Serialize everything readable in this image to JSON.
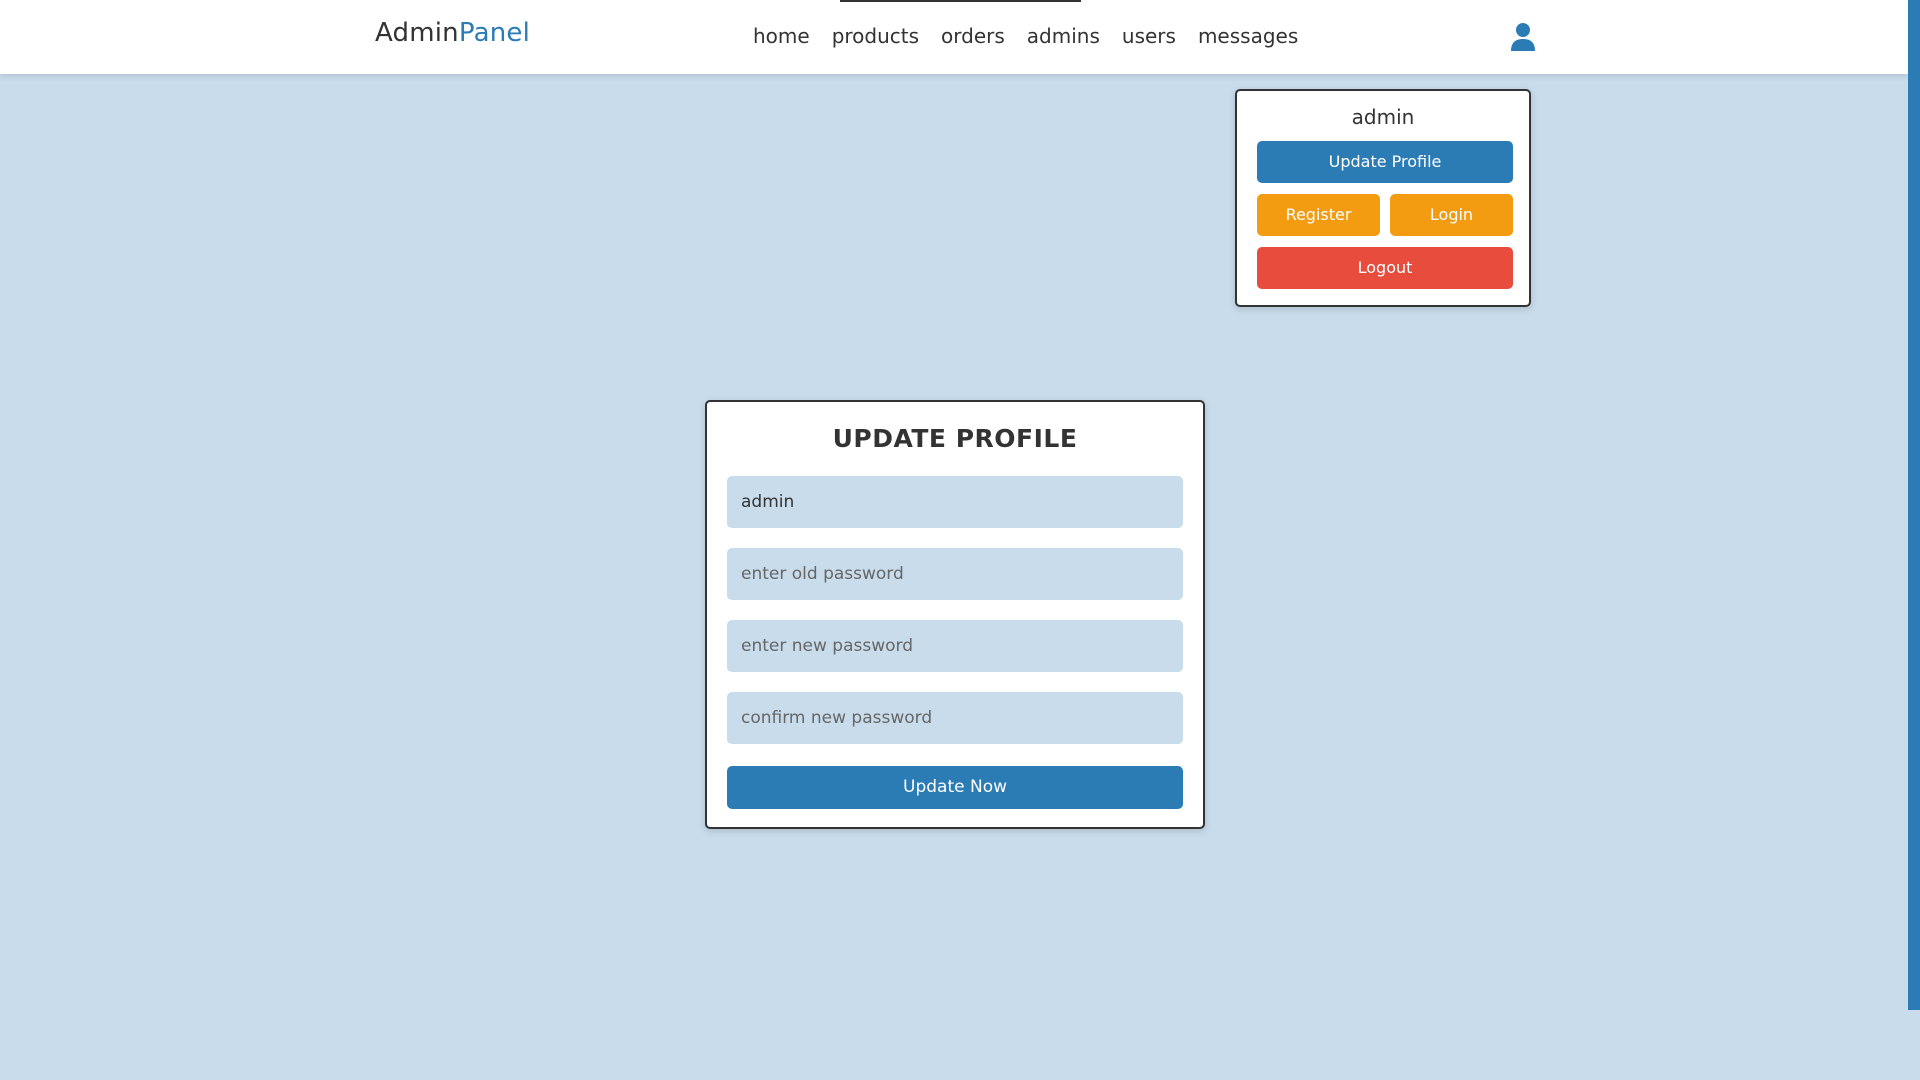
{
  "header": {
    "logo_main": "Admin",
    "logo_accent": "Panel",
    "nav": [
      {
        "label": "home"
      },
      {
        "label": "products"
      },
      {
        "label": "orders"
      },
      {
        "label": "admins"
      },
      {
        "label": "users"
      },
      {
        "label": "messages"
      }
    ],
    "user_icon": "user-icon"
  },
  "profile_menu": {
    "name": "admin",
    "update_label": "Update Profile",
    "register_label": "Register",
    "login_label": "Login",
    "logout_label": "Logout"
  },
  "form": {
    "title": "UPDATE PROFILE",
    "name_value": "admin",
    "old_password_placeholder": "enter old password",
    "new_password_placeholder": "enter new password",
    "confirm_password_placeholder": "confirm new password",
    "submit_label": "Update Now"
  },
  "colors": {
    "accent": "#2b7bb5",
    "background": "#c8dcec",
    "warning": "#f39c12",
    "danger": "#e74c3c"
  }
}
